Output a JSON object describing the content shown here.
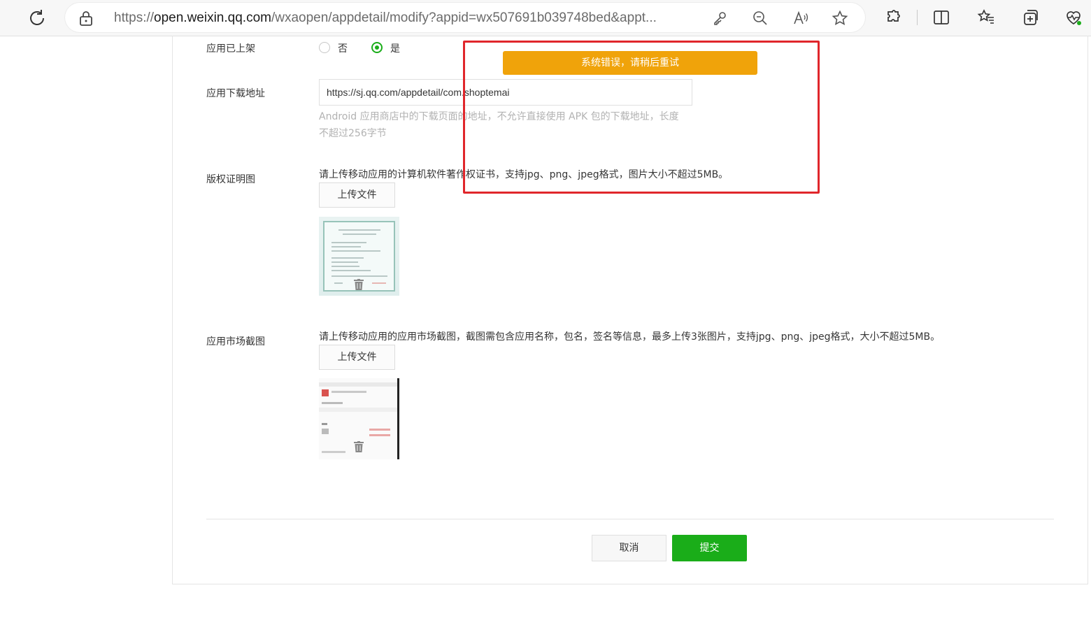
{
  "browser": {
    "url_prefix": "https://",
    "url_domain": "open.weixin.qq.com",
    "url_path": "/wxaopen/appdetail/modify?appid=wx507691b039748bed&appt..."
  },
  "form": {
    "listed": {
      "label": "应用已上架",
      "option_no": "否",
      "option_yes": "是",
      "selected": "是"
    },
    "download_url": {
      "label": "应用下载地址",
      "value": "https://sj.qq.com/appdetail/com.shoptemai",
      "hint_line1": "Android 应用商店中的下载页面的地址，不允许直接使用 APK 包的下载地址，长度",
      "hint_line2": "不超过256字节"
    },
    "copyright": {
      "label": "版权证明图",
      "desc": "请上传移动应用的计算机软件著作权证书，支持jpg、png、jpeg格式，图片大小不超过5MB。",
      "upload_label": "上传文件"
    },
    "screenshot": {
      "label": "应用市场截图",
      "desc": "请上传移动应用的应用市场截图，截图需包含应用名称，包名，签名等信息，最多上传3张图片，支持jpg、png、jpeg格式，大小不超过5MB。",
      "upload_label": "上传文件"
    }
  },
  "actions": {
    "cancel_label": "取消",
    "submit_label": "提交"
  },
  "toast": {
    "message": "系统错误，请稍后重试"
  },
  "colors": {
    "primary": "#1aad19",
    "toast": "#f0a30a",
    "highlight": "#e0262b"
  }
}
